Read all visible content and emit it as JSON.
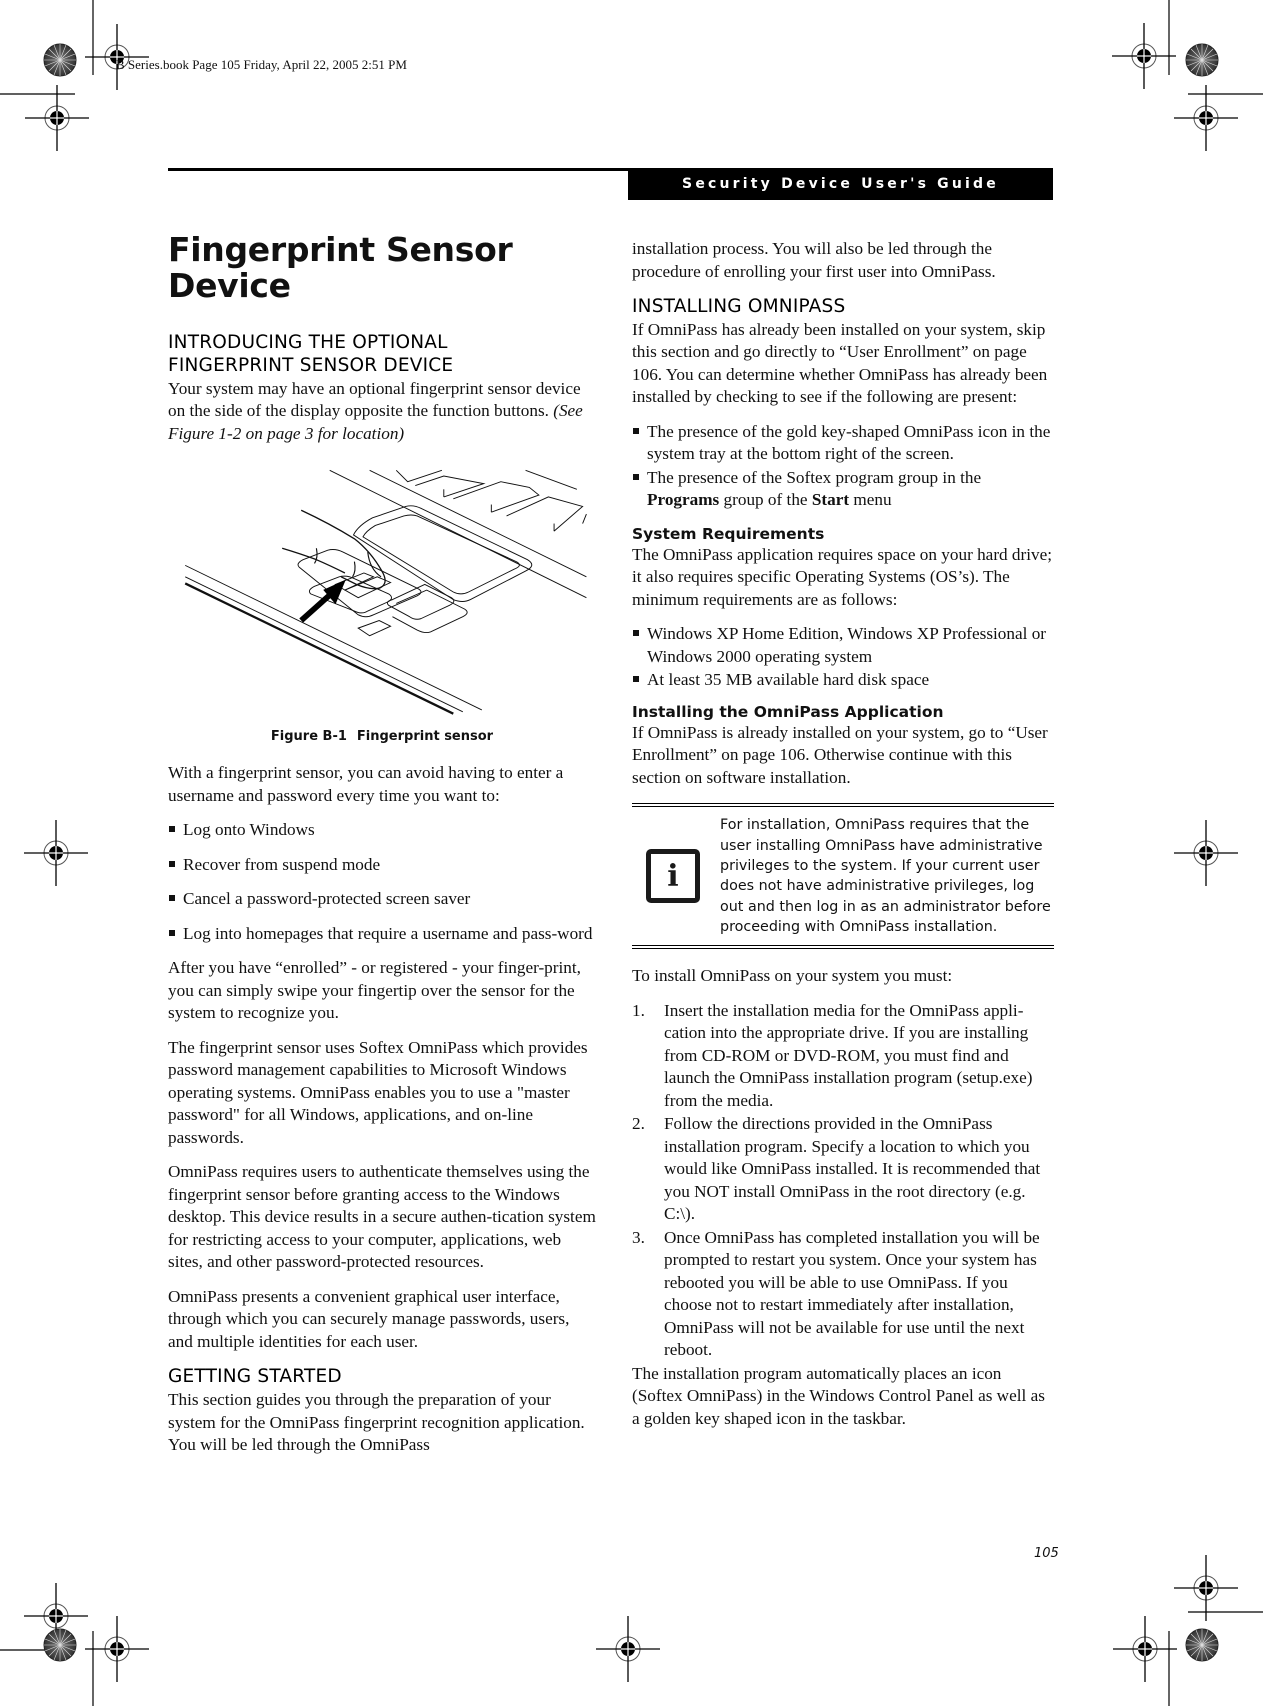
{
  "print_slug": "B Series.book  Page 105  Friday, April 22, 2005  2:51 PM",
  "header": {
    "running_title": "Security Device User's Guide"
  },
  "page_title": "Fingerprint Sensor Device",
  "left": {
    "intro_heading_line1": "INTRODUCING THE OPTIONAL",
    "intro_heading_line2": "FINGERPRINT SENSOR DEVICE",
    "intro_para": "Your system may have an optional fingerprint sensor device on the side of the display opposite the function buttons.",
    "intro_para_ref": "(See Figure 1-2 on page 3 for location)",
    "figure": {
      "number": "Figure B-1",
      "caption": "Fingerprint sensor"
    },
    "avoid_para": "With a fingerprint sensor, you can avoid having to enter a username and password every time you want to:",
    "avoid_list": [
      "Log onto Windows",
      "Recover from suspend mode",
      "Cancel a password-protected screen saver",
      "Log into homepages that require a username and pass-word"
    ],
    "enroll_para": "After you have “enrolled” - or registered - your finger-print, you can simply swipe your fingertip over the sensor for the system to recognize you.",
    "softex_para": "The fingerprint sensor uses Softex OmniPass which provides password management capabilities to Microsoft Windows operating systems. OmniPass enables you to use a \"master password\" for all Windows, applications, and on-line passwords.",
    "auth_para": "OmniPass requires users to authenticate themselves using the fingerprint sensor before granting access to the Windows desktop. This device results in a secure authen-tication system for restricting access to your computer, applications, web sites, and other password-protected resources.",
    "gui_para": "OmniPass presents a convenient graphical user interface, through which you can securely manage passwords, users, and multiple identities for each user.",
    "getting_started_heading": "GETTING STARTED",
    "getting_started_para": "This section guides you through the preparation of your system for the OmniPass fingerprint recognition application. You will be led through the OmniPass"
  },
  "right": {
    "continued_para": "installation process. You will also be led through the procedure of enrolling your first user into OmniPass.",
    "installing_heading": "INSTALLING OMNIPASS",
    "installing_para": "If OmniPass has already been installed on your system, skip this section and go directly to “User Enrollment” on page 106. You can determine whether OmniPass has already been installed by checking to see if the following are present:",
    "presence_list": [
      {
        "text": "The presence of the gold key-shaped OmniPass icon in the system tray at the bottom right of the screen."
      },
      {
        "pre": "The presence of the Softex program group in the ",
        "bold1": "Programs",
        "mid": " group of the ",
        "bold2": "Start",
        "post": " menu"
      }
    ],
    "sysreq_heading": "System Requirements",
    "sysreq_para": "The OmniPass application requires space on your hard drive; it also requires specific Operating Systems (OS’s). The minimum requirements are as follows:",
    "sysreq_list": [
      "Windows XP Home Edition, Windows XP Professional or Windows 2000 operating system",
      "At least 35 MB available hard disk space"
    ],
    "install_app_heading": "Installing the OmniPass Application",
    "install_app_para": "If OmniPass is already installed on your system, go to “User Enrollment” on page 106. Otherwise continue with this section on software installation.",
    "note": {
      "icon": "info-icon",
      "glyph": "i",
      "text": "For installation, OmniPass requires that the user installing OmniPass have administrative privileges to the system. If your current user does not have administrative privileges, log out and then log in as an administrator before proceeding with OmniPass installation."
    },
    "must_para": "To install OmniPass on your system you must:",
    "steps": [
      {
        "n": "1.",
        "text": "Insert the installation media for the OmniPass appli-cation into the appropriate drive. If you are installing from CD-ROM or DVD-ROM, you must find and launch the OmniPass installation program (setup.exe) from the media."
      },
      {
        "n": "2.",
        "text": "Follow the directions provided in the OmniPass installation program. Specify a location to which you would like OmniPass installed. It is recommended that you NOT install OmniPass in the root directory (e.g. C:\\)."
      },
      {
        "n": "3.",
        "text": "Once OmniPass has completed installation you will be prompted to restart you system. Once your system has rebooted you will be able to use OmniPass. If you choose not to restart immediately after installation, OmniPass will not be available for use until the next reboot."
      }
    ],
    "final_para": "The installation program automatically places an icon (Softex OmniPass) in the Windows Control Panel as well as a golden key shaped icon in the taskbar."
  },
  "footer": {
    "page_number": "105"
  }
}
